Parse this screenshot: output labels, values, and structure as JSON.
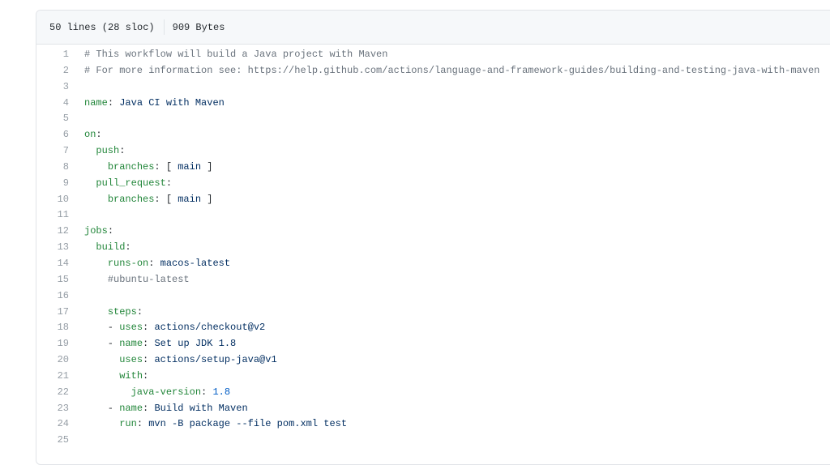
{
  "header": {
    "lines_info": "50 lines (28 sloc)",
    "size": "909 Bytes"
  },
  "colors": {
    "comment": "#6a737d",
    "key": "#22863a",
    "val": "#032f62",
    "num": "#005cc5",
    "plain": "#24292e"
  },
  "lines": [
    {
      "n": "1",
      "tokens": [
        {
          "t": "# This workflow will build a Java project with Maven",
          "c": "comment"
        }
      ]
    },
    {
      "n": "2",
      "tokens": [
        {
          "t": "# For more information see: https://help.github.com/actions/language-and-framework-guides/building-and-testing-java-with-maven",
          "c": "comment"
        }
      ]
    },
    {
      "n": "3",
      "tokens": []
    },
    {
      "n": "4",
      "tokens": [
        {
          "t": "name",
          "c": "key"
        },
        {
          "t": ": ",
          "c": "plain"
        },
        {
          "t": "Java CI with Maven",
          "c": "val"
        }
      ]
    },
    {
      "n": "5",
      "tokens": []
    },
    {
      "n": "6",
      "tokens": [
        {
          "t": "on",
          "c": "key"
        },
        {
          "t": ":",
          "c": "plain"
        }
      ]
    },
    {
      "n": "7",
      "tokens": [
        {
          "t": "  ",
          "c": "plain"
        },
        {
          "t": "push",
          "c": "key"
        },
        {
          "t": ":",
          "c": "plain"
        }
      ]
    },
    {
      "n": "8",
      "tokens": [
        {
          "t": "    ",
          "c": "plain"
        },
        {
          "t": "branches",
          "c": "key"
        },
        {
          "t": ": [ ",
          "c": "plain"
        },
        {
          "t": "main",
          "c": "val"
        },
        {
          "t": " ]",
          "c": "plain"
        }
      ]
    },
    {
      "n": "9",
      "tokens": [
        {
          "t": "  ",
          "c": "plain"
        },
        {
          "t": "pull_request",
          "c": "key"
        },
        {
          "t": ":",
          "c": "plain"
        }
      ]
    },
    {
      "n": "10",
      "tokens": [
        {
          "t": "    ",
          "c": "plain"
        },
        {
          "t": "branches",
          "c": "key"
        },
        {
          "t": ": [ ",
          "c": "plain"
        },
        {
          "t": "main",
          "c": "val"
        },
        {
          "t": " ]",
          "c": "plain"
        }
      ]
    },
    {
      "n": "11",
      "tokens": []
    },
    {
      "n": "12",
      "tokens": [
        {
          "t": "jobs",
          "c": "key"
        },
        {
          "t": ":",
          "c": "plain"
        }
      ]
    },
    {
      "n": "13",
      "tokens": [
        {
          "t": "  ",
          "c": "plain"
        },
        {
          "t": "build",
          "c": "key"
        },
        {
          "t": ":",
          "c": "plain"
        }
      ]
    },
    {
      "n": "14",
      "tokens": [
        {
          "t": "    ",
          "c": "plain"
        },
        {
          "t": "runs-on",
          "c": "key"
        },
        {
          "t": ": ",
          "c": "plain"
        },
        {
          "t": "macos-latest",
          "c": "val"
        }
      ]
    },
    {
      "n": "15",
      "tokens": [
        {
          "t": "    ",
          "c": "plain"
        },
        {
          "t": "#ubuntu-latest",
          "c": "comment"
        }
      ]
    },
    {
      "n": "16",
      "tokens": []
    },
    {
      "n": "17",
      "tokens": [
        {
          "t": "    ",
          "c": "plain"
        },
        {
          "t": "steps",
          "c": "key"
        },
        {
          "t": ":",
          "c": "plain"
        }
      ]
    },
    {
      "n": "18",
      "tokens": [
        {
          "t": "    - ",
          "c": "plain"
        },
        {
          "t": "uses",
          "c": "key"
        },
        {
          "t": ": ",
          "c": "plain"
        },
        {
          "t": "actions/checkout@v2",
          "c": "val"
        }
      ]
    },
    {
      "n": "19",
      "tokens": [
        {
          "t": "    - ",
          "c": "plain"
        },
        {
          "t": "name",
          "c": "key"
        },
        {
          "t": ": ",
          "c": "plain"
        },
        {
          "t": "Set up JDK 1.8",
          "c": "val"
        }
      ]
    },
    {
      "n": "20",
      "tokens": [
        {
          "t": "      ",
          "c": "plain"
        },
        {
          "t": "uses",
          "c": "key"
        },
        {
          "t": ": ",
          "c": "plain"
        },
        {
          "t": "actions/setup-java@v1",
          "c": "val"
        }
      ]
    },
    {
      "n": "21",
      "tokens": [
        {
          "t": "      ",
          "c": "plain"
        },
        {
          "t": "with",
          "c": "key"
        },
        {
          "t": ":",
          "c": "plain"
        }
      ]
    },
    {
      "n": "22",
      "tokens": [
        {
          "t": "        ",
          "c": "plain"
        },
        {
          "t": "java-version",
          "c": "key"
        },
        {
          "t": ": ",
          "c": "plain"
        },
        {
          "t": "1.8",
          "c": "num"
        }
      ]
    },
    {
      "n": "23",
      "tokens": [
        {
          "t": "    - ",
          "c": "plain"
        },
        {
          "t": "name",
          "c": "key"
        },
        {
          "t": ": ",
          "c": "plain"
        },
        {
          "t": "Build with Maven",
          "c": "val"
        }
      ]
    },
    {
      "n": "24",
      "tokens": [
        {
          "t": "      ",
          "c": "plain"
        },
        {
          "t": "run",
          "c": "key"
        },
        {
          "t": ": ",
          "c": "plain"
        },
        {
          "t": "mvn -B package --file pom.xml test",
          "c": "val"
        }
      ]
    },
    {
      "n": "25",
      "tokens": []
    }
  ]
}
